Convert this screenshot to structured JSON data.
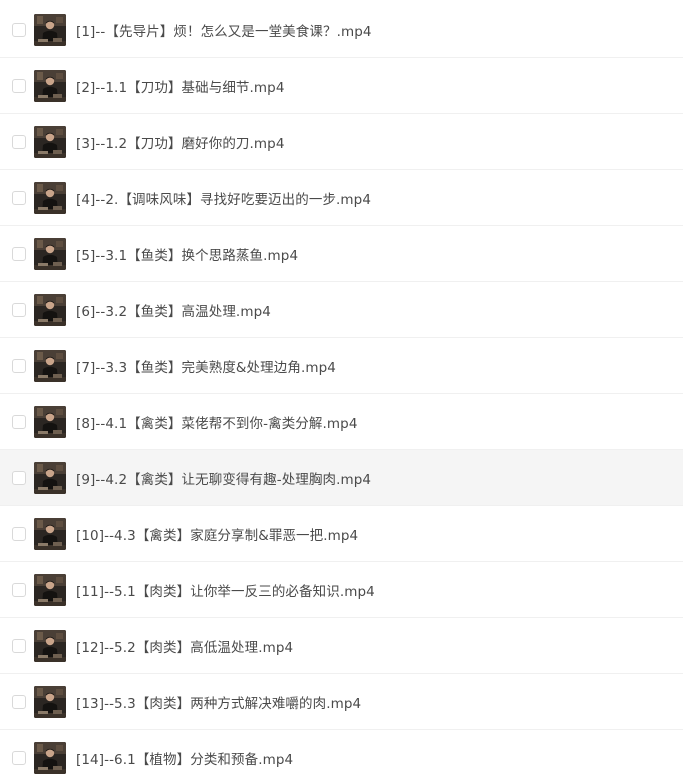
{
  "files": [
    {
      "name": "[1]--【先导片】烦！怎么又是一堂美食课？.mp4",
      "highlighted": false
    },
    {
      "name": "[2]--1.1【刀功】基础与细节.mp4",
      "highlighted": false
    },
    {
      "name": "[3]--1.2【刀功】磨好你的刀.mp4",
      "highlighted": false
    },
    {
      "name": "[4]--2.【调味风味】寻找好吃要迈出的一步.mp4",
      "highlighted": false
    },
    {
      "name": "[5]--3.1【鱼类】换个思路蒸鱼.mp4",
      "highlighted": false
    },
    {
      "name": "[6]--3.2【鱼类】高温处理.mp4",
      "highlighted": false
    },
    {
      "name": "[7]--3.3【鱼类】完美熟度&处理边角.mp4",
      "highlighted": false
    },
    {
      "name": "[8]--4.1【禽类】菜佬帮不到你-禽类分解.mp4",
      "highlighted": false
    },
    {
      "name": "[9]--4.2【禽类】让无聊变得有趣-处理胸肉.mp4",
      "highlighted": true
    },
    {
      "name": "[10]--4.3【禽类】家庭分享制&罪恶一把.mp4",
      "highlighted": false
    },
    {
      "name": "[11]--5.1【肉类】让你举一反三的必备知识.mp4",
      "highlighted": false
    },
    {
      "name": "[12]--5.2【肉类】高低温处理.mp4",
      "highlighted": false
    },
    {
      "name": "[13]--5.3【肉类】两种方式解决难嚼的肉.mp4",
      "highlighted": false
    },
    {
      "name": "[14]--6.1【植物】分类和预备.mp4",
      "highlighted": false
    }
  ],
  "thumbnail_icon": "video-thumbnail-icon",
  "colors": {
    "row_highlight": "#f5f5f5",
    "text": "#4a4a4a",
    "divider": "#f0f0f0",
    "checkbox_border": "#d9d9d9"
  }
}
